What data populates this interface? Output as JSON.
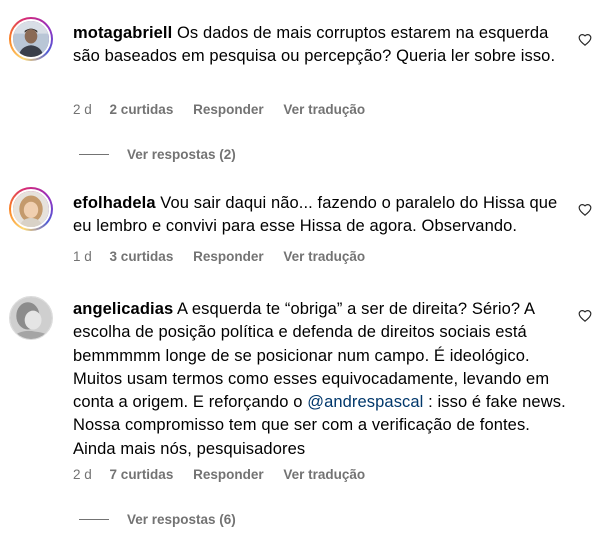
{
  "comments": [
    {
      "username": "motagabriell",
      "text": "Os dados de mais corruptos estarem na esquerda são baseados em pesquisa ou percepção? Queria ler sobre isso.",
      "time": "2 d",
      "likes": "2 curtidas",
      "reply": "Responder",
      "translate": "Ver tradução",
      "view_replies": "Ver respostas (2)"
    },
    {
      "username": "efolhadela",
      "text": "Vou sair daqui não... fazendo o paralelo do Hissa que eu lembro e convivi para esse Hissa de agora. Observando.",
      "time": "1 d",
      "likes": "3 curtidas",
      "reply": "Responder",
      "translate": "Ver tradução"
    },
    {
      "username": "angelicadias",
      "text_before_mention": "A esquerda te “obriga” a ser de direita? Sério? A escolha de posição política e defenda de direitos sociais está bemmmmm longe de se posicionar num campo. É ideológico. Muitos usam termos como esses equivocadamente, levando em conta a origem. E reforçando o ",
      "mention": "@andrespascal",
      "text_after_mention": " : isso é fake news. Nossa compromisso tem que ser com a verificação de fontes. Ainda mais nós, pesquisadores",
      "time": "2 d",
      "likes": "7 curtidas",
      "reply": "Responder",
      "translate": "Ver tradução",
      "view_replies": "Ver respostas (6)"
    }
  ],
  "colors": {
    "text": "#000000",
    "secondary": "#737373",
    "mention": "#00376b"
  },
  "icons": {
    "like": "heart-outline-icon"
  }
}
